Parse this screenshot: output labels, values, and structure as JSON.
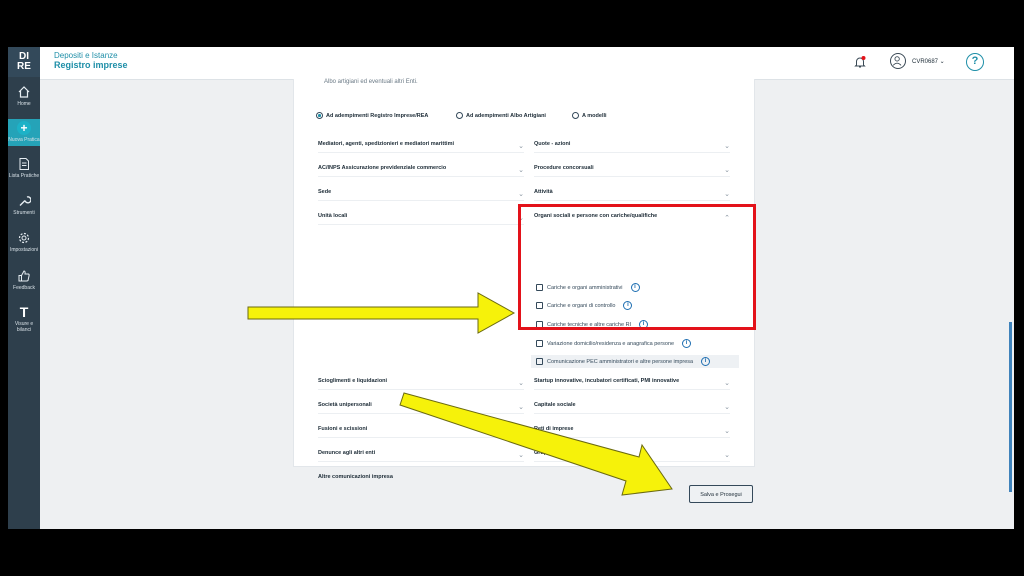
{
  "sidebar": {
    "logo_top": "DI",
    "logo_bottom": "RE",
    "items": [
      {
        "label": "Home",
        "icon": "home-icon"
      },
      {
        "label": "Nuova Pratica",
        "icon": "plus-icon"
      },
      {
        "label": "Lista Pratiche",
        "icon": "document-icon"
      },
      {
        "label": "Strumenti",
        "icon": "wrench-icon"
      },
      {
        "label": "Impostazioni",
        "icon": "gear-icon"
      },
      {
        "label": "Feedback",
        "icon": "thumbs-up-icon"
      },
      {
        "label": "Visure e bilanci",
        "icon": "text-icon"
      }
    ]
  },
  "header": {
    "subtitle": "Depositi e Istanze",
    "title": "Registro imprese",
    "user": "CVR0687 ⌄",
    "help": "?"
  },
  "card": {
    "intro": "Albo artigiani ed eventuali altri Enti.",
    "radios": [
      {
        "label": "Ad adempimenti Registro Imprese/REA",
        "selected": true
      },
      {
        "label": "Ad adempimenti Albo Artigiani",
        "selected": false
      },
      {
        "label": "A modelli",
        "selected": false
      }
    ],
    "left_sections": [
      "Mediatori, agenti, spedizionieri e mediatori marittimi",
      "AC/INPS Assicurazione previdenziale commercio",
      "Sede",
      "Unità locali"
    ],
    "right_sections": [
      "Quote - azioni",
      "Procedure concorsuali",
      "Attività"
    ],
    "expanded_section": "Organi sociali e persone con cariche/qualifiche",
    "expanded_items": [
      "Cariche e organi amministrativi",
      "Cariche e organi di controllo",
      "Cariche tecniche e altre cariche RI",
      "Variazione domicilio/residenza e anagrafica persone",
      "Comunicazione PEC amministratori e altre persone impresa"
    ],
    "lower_left": [
      "Scioglimenti e liquidazioni",
      "Società unipersonali",
      "Fusioni e scissioni",
      "Denunce agli altri enti",
      "Altre comunicazioni impresa"
    ],
    "lower_right": [
      "Startup innovative, incubatori certificati, PMI innovative",
      "Capitale sociale",
      "Reti di imprese",
      "Gruppi societari"
    ]
  },
  "footer": {
    "save_label": "Salva e Prosegui"
  },
  "colors": {
    "accent": "#1f8fa8",
    "sidebar": "#2e3f4c",
    "highlight_box": "#e3121a",
    "arrow_fill": "#f6f20a"
  }
}
